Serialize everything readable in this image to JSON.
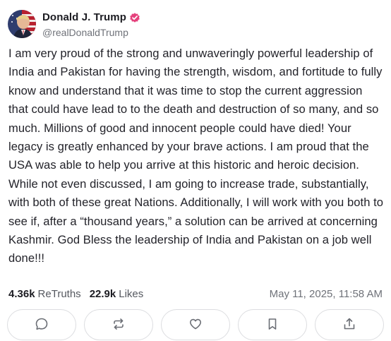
{
  "post": {
    "author": {
      "display_name": "Donald J. Trump",
      "handle": "@realDonaldTrump",
      "verified_icon": "verified-badge-icon",
      "badge_color": "#e5417c"
    },
    "text": "I am very proud of the strong and unwaveringly powerful leadership of India and Pakistan for having the strength, wisdom, and fortitude to fully know and understand that it was time to stop the current aggression that could have lead to to the death and destruction of so many, and so much. Millions of good and innocent people could have died! Your legacy is greatly enhanced by your brave actions. I am proud that the USA was able to help you arrive at this historic and heroic decision. While not even discussed, I am going to increase trade, substantially, with both of these great Nations. Additionally, I will work with you both to see if, after a “thousand years,” a solution can be arrived at concerning Kashmir. God Bless the leadership of India and Pakistan on a job well done!!!",
    "stats": {
      "retruths_count": "4.36k",
      "retruths_label": "ReTruths",
      "likes_count": "22.9k",
      "likes_label": "Likes"
    },
    "timestamp": "May 11, 2025, 11:58 AM"
  },
  "actions": [
    {
      "name": "reply-button",
      "icon": "comment-icon"
    },
    {
      "name": "retruth-button",
      "icon": "repost-icon"
    },
    {
      "name": "like-button",
      "icon": "heart-icon"
    },
    {
      "name": "bookmark-button",
      "icon": "bookmark-icon"
    },
    {
      "name": "share-button",
      "icon": "share-icon"
    }
  ]
}
